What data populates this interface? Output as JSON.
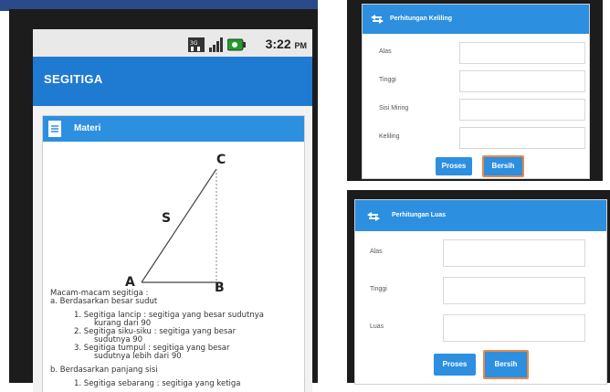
{
  "status_bar": {
    "time": "3:22",
    "am_pm": "PM"
  },
  "app": {
    "title": "SEGITIGA"
  },
  "materi": {
    "header": "Materi",
    "diagram_labels": {
      "c": "C",
      "s": "S",
      "a": "A",
      "b": "B"
    },
    "lines": [
      {
        "text": "Macam-macam segitiga :",
        "indent": 0
      },
      {
        "text": "a. Berdasarkan besar sudut",
        "indent": 0
      },
      {
        "text": "",
        "indent": 0
      },
      {
        "text": "1. Segitiga lancip : segitiga yang besar sudutnya",
        "indent": 1
      },
      {
        "text": "kurang dari 90",
        "indent": 2
      },
      {
        "text": "2. Segitiga siku-siku : segitiga yang besar",
        "indent": 1
      },
      {
        "text": "sudutnya 90",
        "indent": 2
      },
      {
        "text": "3. Segitiga tumpul : segitiga yang besar",
        "indent": 1
      },
      {
        "text": "sudutnya lebih dari 90",
        "indent": 2
      },
      {
        "text": "",
        "indent": 0
      },
      {
        "text": "b. Berdasarkan panjang sisi",
        "indent": 0
      },
      {
        "text": "",
        "indent": 0
      },
      {
        "text": "1. Segitiga sebarang : segitiga yang ketiga",
        "indent": 1
      }
    ]
  },
  "keliling": {
    "header": "Perhitungan Keliling",
    "fields": [
      {
        "label": "Alas",
        "value": ""
      },
      {
        "label": "Tinggi",
        "value": ""
      },
      {
        "label": "Sisi Miring",
        "value": ""
      },
      {
        "label": "Keliling",
        "value": ""
      }
    ],
    "proses_label": "Proses",
    "bersih_label": "Bersih"
  },
  "luas": {
    "header": "Perhitungan Luas",
    "fields": [
      {
        "label": "Alas",
        "value": ""
      },
      {
        "label": "Tinggi",
        "value": ""
      },
      {
        "label": "Luas",
        "value": ""
      }
    ],
    "proses_label": "Proses",
    "bersih_label": "Bersih"
  },
  "colors": {
    "accent": "#1f7ad2",
    "header": "#2c8fe0",
    "selected_border": "#e8884a"
  }
}
